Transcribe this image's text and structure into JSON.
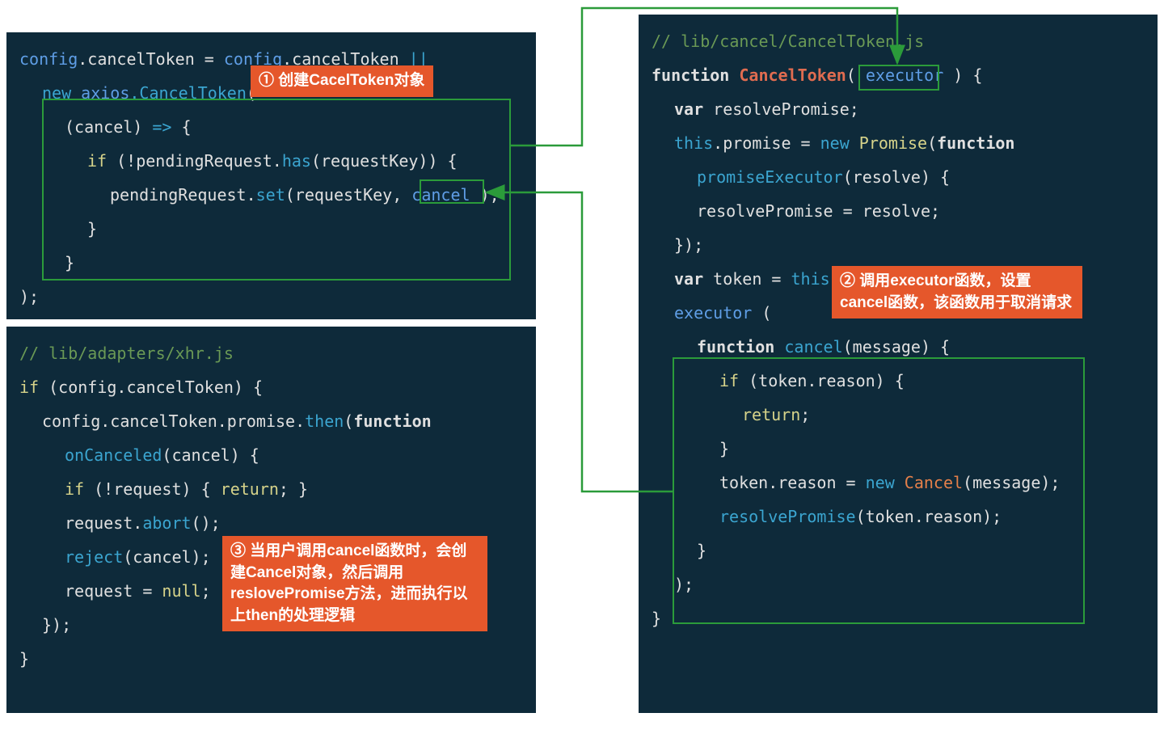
{
  "panel1": {
    "l1_a": "config",
    "l1_b": ".cancelToken = ",
    "l1_c": "config",
    "l1_d": ".cancelToken ",
    "l1_e": "||",
    "l2_a": "new ",
    "l2_b": "axios",
    "l2_c": ".CancelToken",
    "l2_d": "(",
    "l3_a": "(cancel) ",
    "l3_b": "=>",
    "l3_c": " {",
    "l4_a": "if ",
    "l4_b": "(!pendingRequest.",
    "l4_c": "has",
    "l4_d": "(requestKey)) {",
    "l5_a": "pendingRequest.",
    "l5_b": "set",
    "l5_c": "(requestKey, ",
    "l5_d": "cancel",
    "l5_e": " );",
    "l6": "}",
    "l7": "}",
    "l8": ");"
  },
  "panel2": {
    "l1": "// lib/adapters/xhr.js",
    "l2_a": "if ",
    "l2_b": "(config.cancelToken) {",
    "l3_a": "config.cancelToken.promise.",
    "l3_b": "then",
    "l3_c": "(",
    "l3_d": "function",
    "l4_a": "onCanceled",
    "l4_b": "(cancel) {",
    "l5_a": "if ",
    "l5_b": "(!request) { ",
    "l5_c": "return",
    "l5_d": "; }",
    "l6_a": "request.",
    "l6_b": "abort",
    "l6_c": "();",
    "l7_a": "reject",
    "l7_b": "(cancel);",
    "l8_a": "request = ",
    "l8_b": "null",
    "l8_c": ";",
    "l9": "});",
    "l10": "}"
  },
  "panel3": {
    "l1": "// lib/cancel/CancelToken.js",
    "l2_a": "function ",
    "l2_b": "CancelToken",
    "l2_c": "( ",
    "l2_d": "executor",
    "l2_e": " ) {",
    "l3_a": "var ",
    "l3_b": "resolvePromise;",
    "l4_a": "this",
    "l4_b": ".promise = ",
    "l4_c": "new ",
    "l4_d": "Promise",
    "l4_e": "(",
    "l4_f": "function",
    "l5_a": "promiseExecutor",
    "l5_b": "(resolve) {",
    "l6_a": "resolvePromise = resolve;",
    "l7": "});",
    "l8_a": "var ",
    "l8_b": "token = ",
    "l8_c": "this",
    "l8_d": ";",
    "l9_a": "executor",
    "l9_b": " (",
    "l10_a": "function ",
    "l10_b": "cancel",
    "l10_c": "(message) {",
    "l11_a": "if ",
    "l11_b": "(token.reason) {",
    "l12_a": "return",
    "l12_b": ";",
    "l13": "}",
    "l14_a": "token.reason = ",
    "l14_b": "new ",
    "l14_c": "Cancel",
    "l14_d": "(message);",
    "l15_a": "resolvePromise",
    "l15_b": "(token.reason);",
    "l16": "}",
    "l17": ");",
    "l18": "}"
  },
  "annotations": {
    "a1": "① 创建CacelToken对象",
    "a2": "② 调用executor函数，设置cancel函数，该函数用于取消请求",
    "a3": "③ 当用户调用cancel函数时，会创建Cancel对象，然后调用reslovePromise方法，进而执行以上then的处理逻辑"
  }
}
